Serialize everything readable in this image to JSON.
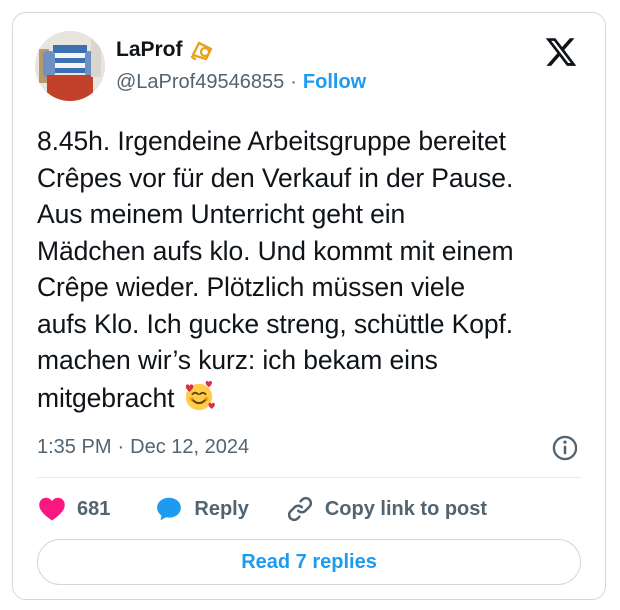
{
  "author": {
    "display_name": "LaProf",
    "handle": "@LaProf49546855",
    "separator": "·",
    "follow_label": "Follow"
  },
  "tweet": {
    "text": "8.45h. Irgendeine Arbeitsgruppe bereitet\nCrêpes vor für den Verkauf in der Pause.\nAus meinem Unterricht geht ein\nMädchen aufs klo. Und kommt mit einem\nCrêpe wieder. Plötzlich müssen viele\naufs Klo. Ich gucke streng, schüttle Kopf.\nmachen wir’s kurz: ich bekam eins\nmitgebracht ",
    "emoji": "smiling-face-with-hearts-icon",
    "time": "1:35 PM",
    "separator": "·",
    "date": "Dec 12, 2024"
  },
  "actions": {
    "likes": "681",
    "reply_label": "Reply",
    "copy_label": "Copy link to post"
  },
  "footer": {
    "read_replies_label": "Read 7 replies"
  },
  "colors": {
    "accent": "#1d9bf0",
    "like": "#f91880",
    "muted": "#536471",
    "border": "#cfd9de"
  }
}
